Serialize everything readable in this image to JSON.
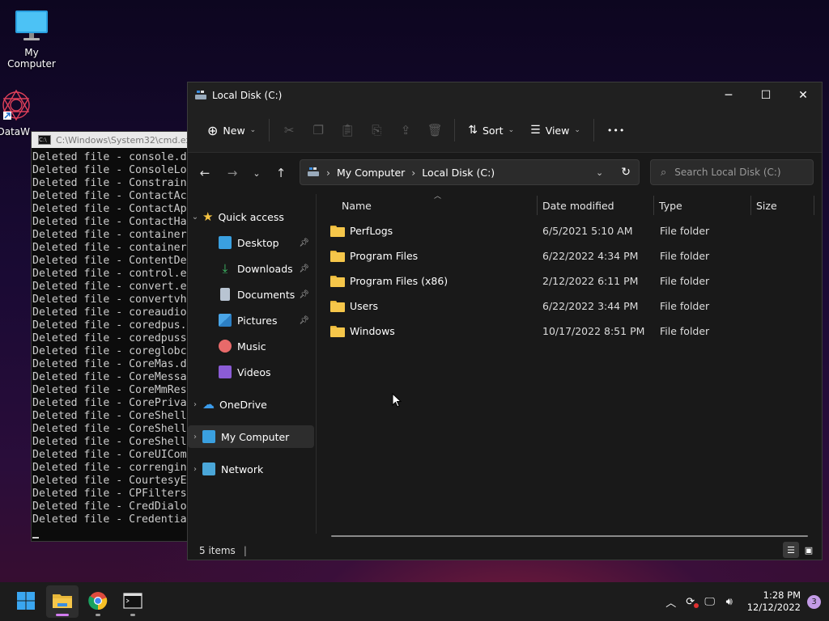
{
  "desktop": {
    "icons": [
      {
        "label": "My Computer",
        "icon": "monitor-icon"
      },
      {
        "label": "DataW",
        "icon": "app-shortcut-icon"
      }
    ]
  },
  "cmd": {
    "title": "C:\\Windows\\System32\\cmd.ex",
    "lines": [
      "Deleted file - console.d",
      "Deleted file - ConsoleLo",
      "Deleted file - Constrain",
      "Deleted file - ContactAc",
      "Deleted file - ContactAp",
      "Deleted file - ContactHa",
      "Deleted file - container",
      "Deleted file - container",
      "Deleted file - ContentDe",
      "Deleted file - control.e",
      "Deleted file - convert.e",
      "Deleted file - convertvh",
      "Deleted file - coreaudio",
      "Deleted file - coredpus.",
      "Deleted file - coredpuss",
      "Deleted file - coreglobc",
      "Deleted file - CoreMas.d",
      "Deleted file - CoreMessa",
      "Deleted file - CoreMmRes",
      "Deleted file - CorePriva",
      "Deleted file - CoreShell",
      "Deleted file - CoreShell",
      "Deleted file - CoreShell",
      "Deleted file - CoreUICom",
      "Deleted file - correngin",
      "Deleted file - CourtesyE",
      "Deleted file - CPFilters",
      "Deleted file - CredDialo",
      "Deleted file - Credentia"
    ]
  },
  "explorer": {
    "title": "Local Disk (C:)",
    "toolbar": {
      "new_label": "New",
      "sort_label": "Sort",
      "view_label": "View",
      "more_label": "•••"
    },
    "breadcrumb": [
      "My Computer",
      "Local Disk (C:)"
    ],
    "search_placeholder": "Search Local Disk (C:)",
    "sidebar": {
      "quick_access": "Quick access",
      "items": [
        {
          "label": "Desktop",
          "pinned": true
        },
        {
          "label": "Downloads",
          "pinned": true
        },
        {
          "label": "Documents",
          "pinned": true
        },
        {
          "label": "Pictures",
          "pinned": true
        },
        {
          "label": "Music",
          "pinned": false
        },
        {
          "label": "Videos",
          "pinned": false
        }
      ],
      "onedrive": "OneDrive",
      "my_computer": "My Computer",
      "network": "Network"
    },
    "columns": {
      "name": "Name",
      "date": "Date modified",
      "type": "Type",
      "size": "Size"
    },
    "rows": [
      {
        "name": "PerfLogs",
        "date": "6/5/2021 5:10 AM",
        "type": "File folder"
      },
      {
        "name": "Program Files",
        "date": "6/22/2022 4:34 PM",
        "type": "File folder"
      },
      {
        "name": "Program Files (x86)",
        "date": "2/12/2022 6:11 PM",
        "type": "File folder"
      },
      {
        "name": "Users",
        "date": "6/22/2022 3:44 PM",
        "type": "File folder"
      },
      {
        "name": "Windows",
        "date": "10/17/2022 8:51 PM",
        "type": "File folder"
      }
    ],
    "status": "5 items"
  },
  "taskbar": {
    "apps": [
      "start-icon",
      "file-explorer-icon",
      "chrome-icon",
      "terminal-icon"
    ],
    "clock_time": "1:28 PM",
    "clock_date": "12/12/2022",
    "notifications": "3"
  },
  "colors": {
    "accent": "#d27cf0",
    "folder": "#f5c64a",
    "window_bg": "#191919"
  }
}
